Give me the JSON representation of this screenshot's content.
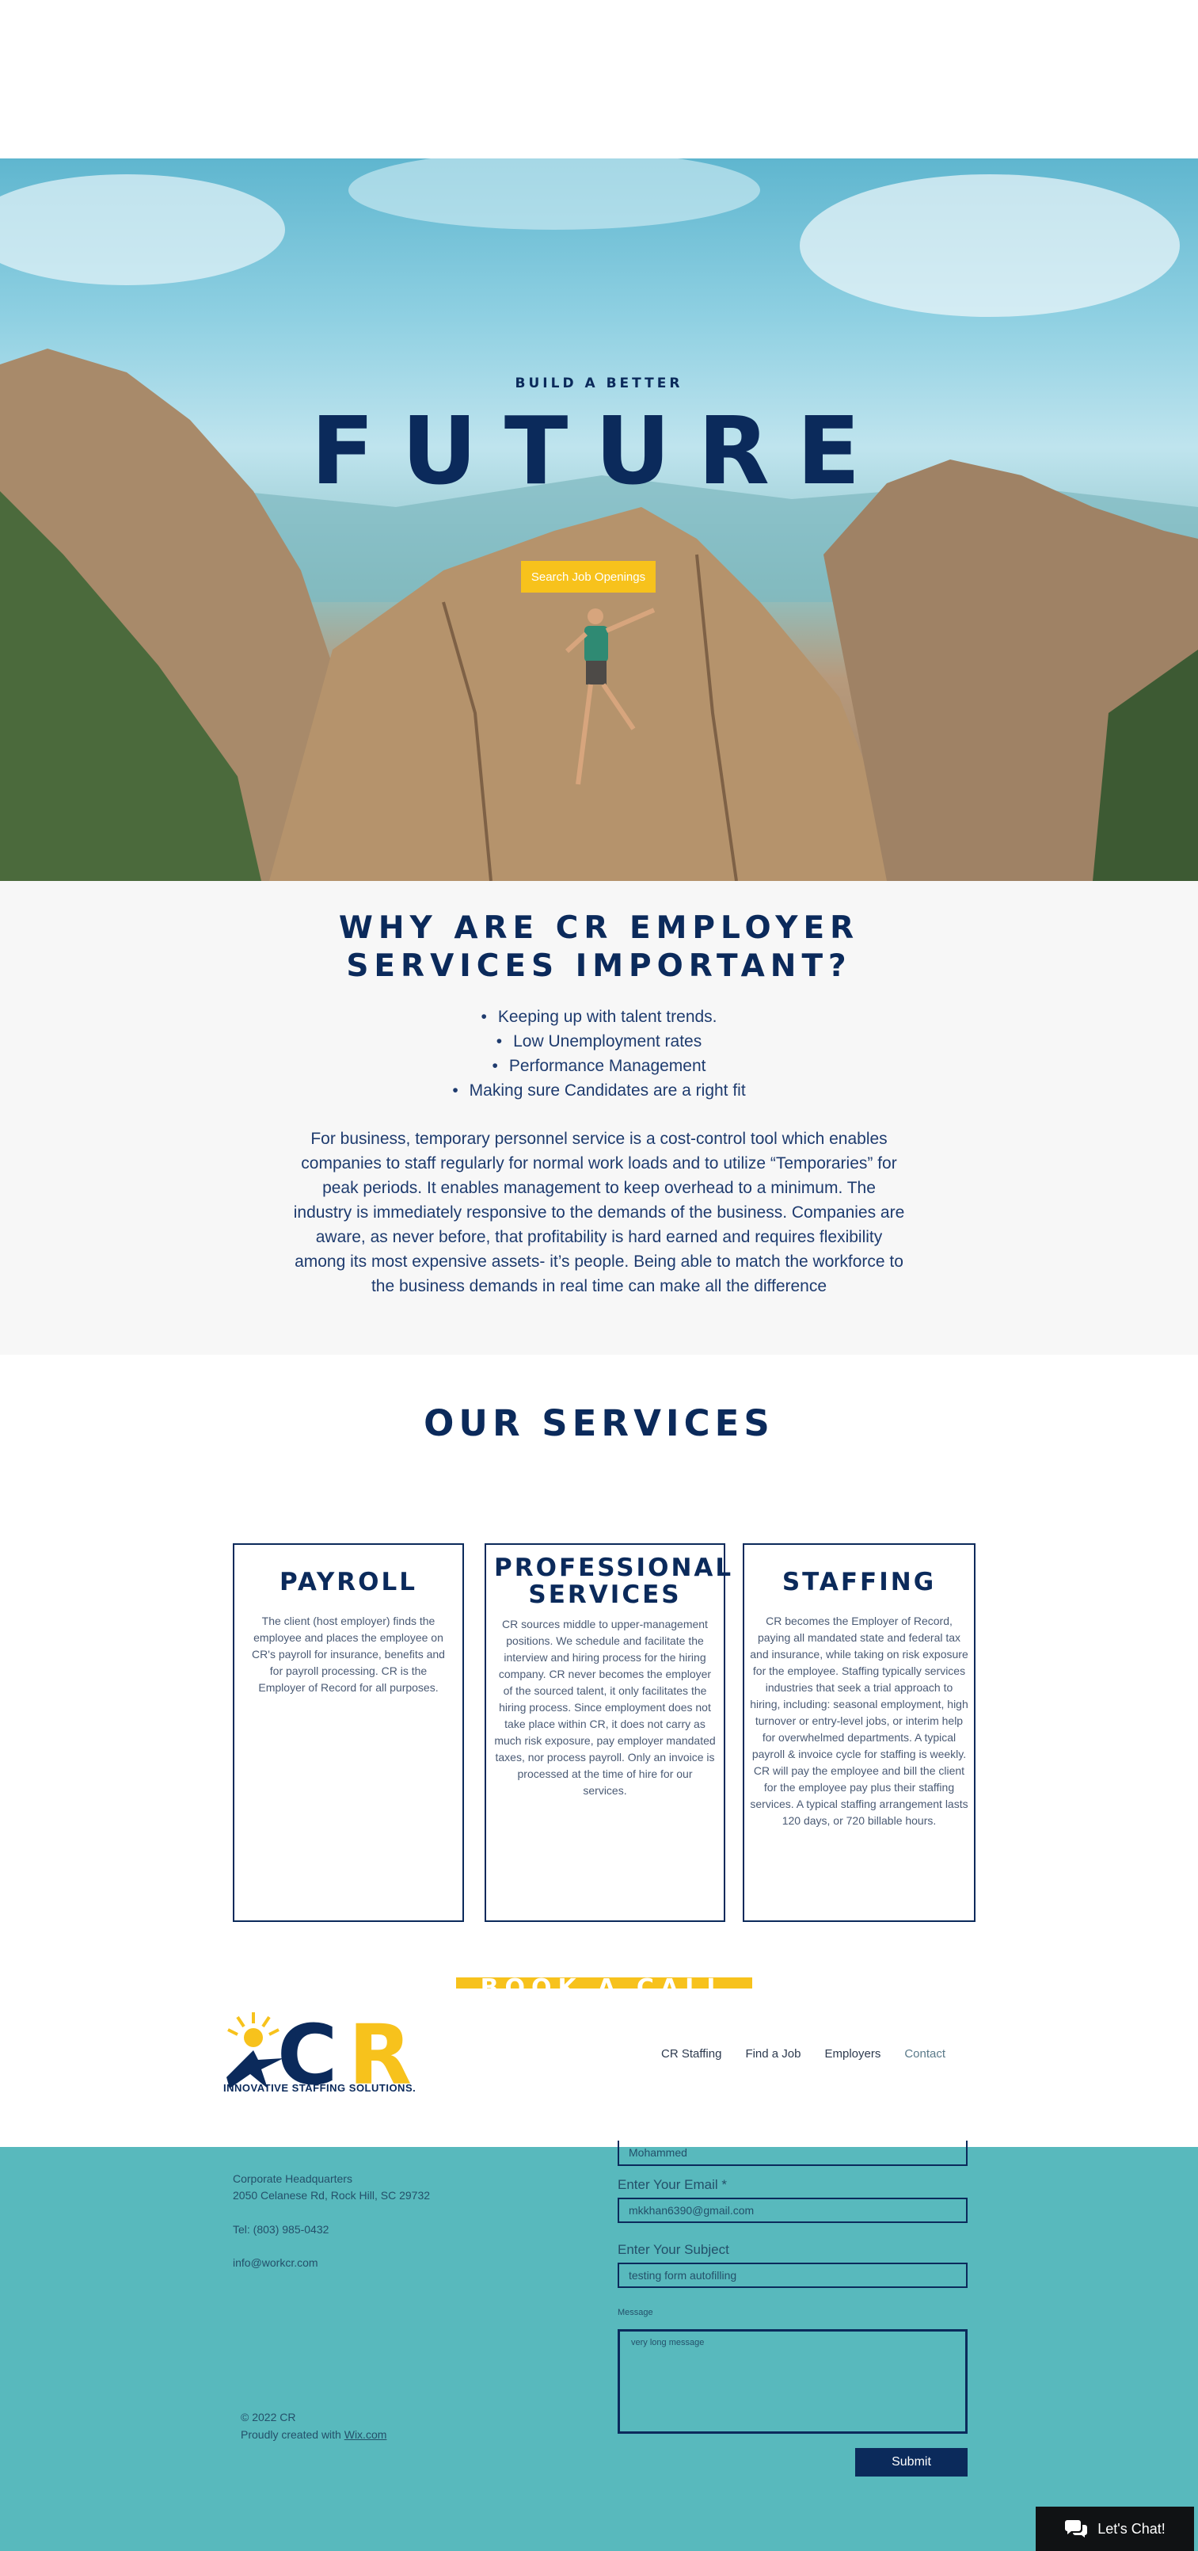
{
  "hero": {
    "kicker": "BUILD A BETTER",
    "title": "FUTURE",
    "button_label": "Search Job Openings"
  },
  "why": {
    "heading_line1": "WHY ARE CR EMPLOYER",
    "heading_line2": "SERVICES IMPORTANT?",
    "bullets": [
      "Keeping up with talent trends.",
      "Low Unemployment rates",
      "Performance Management",
      "Making sure Candidates are a right fit"
    ],
    "paragraph": "For business, temporary personnel service is a cost-control tool which enables companies to staff regularly for normal work loads and to utilize “Temporaries” for peak periods. It enables management to keep overhead to a minimum. The industry is immediately responsive to the demands of the business. Companies are aware, as never before, that profitability is hard earned and requires flexibility among its most expensive assets- it’s people. Being able to match the workforce to the business demands in real time can make all the difference"
  },
  "services": {
    "title": "OUR SERVICES",
    "cards": [
      {
        "title": "PAYROLL",
        "text": "The client (host employer) finds the employee and places the employee on CR's payroll for insurance, benefits and for payroll processing.   CR is the Employer of Record for all purposes."
      },
      {
        "title": "PROFESSIONAL SERVICES",
        "text": "CR sources middle to upper-management positions. We schedule and facilitate the interview and hiring process for the hiring company. CR never becomes the employer of the sourced talent, it only facilitates the hiring process. Since employment does not take place within CR, it does not carry as much risk exposure, pay employer mandated taxes, nor process payroll. Only an invoice is processed at the time of hire for our services."
      },
      {
        "title": "STAFFING",
        "text": "CR becomes the Employer of Record, paying all mandated state and federal tax and insurance, while taking on risk exposure for the employee. Staffing typically services industries that seek a trial approach to hiring, including: seasonal employment, high turnover or entry-level jobs, or interim help for overwhelmed departments. A typical payroll & invoice cycle for staffing is weekly. CR will pay the employee and bill the client for the employee pay plus their staffing services. A typical staffing arrangement lasts 120 days, or 720 billable hours."
      }
    ],
    "book_label": "BOOK A CALL"
  },
  "header": {
    "logo_text": "CR",
    "logo_tagline": "INNOVATIVE STAFFING SOLUTIONS.",
    "nav": [
      "CR Staffing",
      "Find a Job",
      "Employers",
      "Contact"
    ]
  },
  "contact": {
    "hq_label": "Corporate Headquarters",
    "address": "2050 Celanese Rd, Rock Hill, SC 29732",
    "tel": "Tel: (803) 985-0432",
    "email": "info@workcr.com",
    "name_value": "Mohammed",
    "email_label": "Enter Your Email *",
    "email_value": "mkkhan6390@gmail.com",
    "subject_label": "Enter Your Subject",
    "subject_value": "testing form autofilling",
    "message_label": "Message",
    "message_value": "very long message",
    "submit_label": "Submit",
    "copyright": "© 2022 CR",
    "created_prefix": "Proudly created with ",
    "created_link": "Wix.com"
  },
  "chat": {
    "label": "Let's Chat!",
    "icon": "chat-bubbles-icon"
  },
  "colors": {
    "navy": "#0b2a5b",
    "yellow": "#f7c21c",
    "teal": "#58b9bd"
  }
}
